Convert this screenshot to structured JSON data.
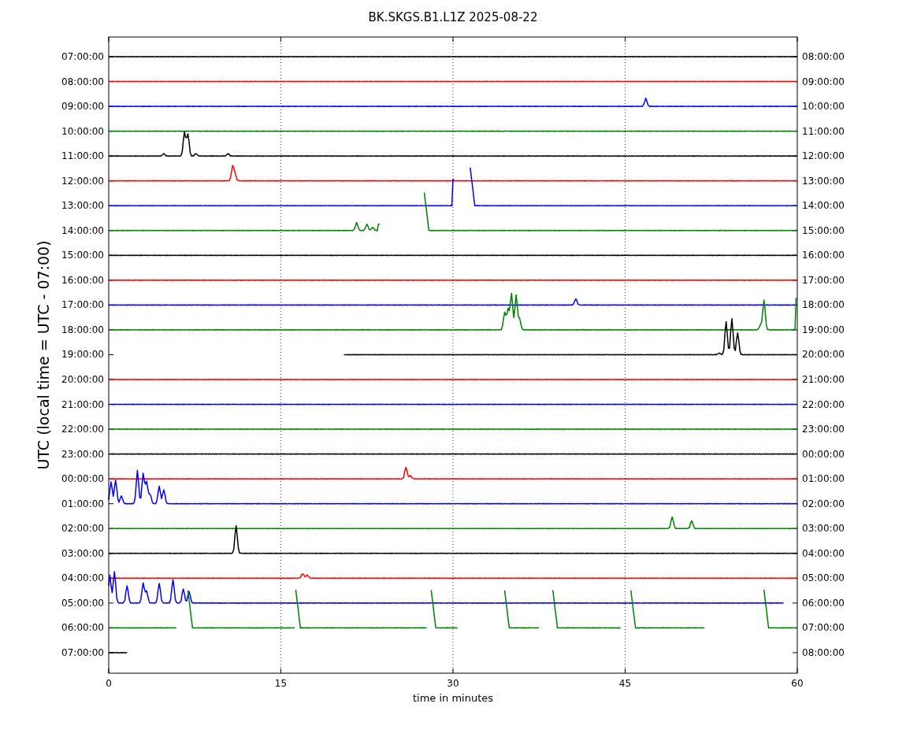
{
  "title": "BK.SKGS.B1.L1Z 2025-08-22",
  "ylabel": "UTC (local time = UTC - 07:00)",
  "xlabel": "time in minutes",
  "xticks": [
    "0",
    "15",
    "30",
    "45",
    "60"
  ],
  "rows": [
    {
      "left": "07:00:00",
      "right": "08:00:00",
      "color": "#000000"
    },
    {
      "left": "08:00:00",
      "right": "09:00:00",
      "color": "#ff0000"
    },
    {
      "left": "09:00:00",
      "right": "10:00:00",
      "color": "#0000ff"
    },
    {
      "left": "10:00:00",
      "right": "11:00:00",
      "color": "#008000"
    },
    {
      "left": "11:00:00",
      "right": "12:00:00",
      "color": "#000000"
    },
    {
      "left": "12:00:00",
      "right": "13:00:00",
      "color": "#ff0000"
    },
    {
      "left": "13:00:00",
      "right": "14:00:00",
      "color": "#0000ff"
    },
    {
      "left": "14:00:00",
      "right": "15:00:00",
      "color": "#008000"
    },
    {
      "left": "15:00:00",
      "right": "16:00:00",
      "color": "#000000"
    },
    {
      "left": "16:00:00",
      "right": "17:00:00",
      "color": "#ff0000"
    },
    {
      "left": "17:00:00",
      "right": "18:00:00",
      "color": "#0000ff"
    },
    {
      "left": "18:00:00",
      "right": "19:00:00",
      "color": "#008000"
    },
    {
      "left": "19:00:00",
      "right": "20:00:00",
      "color": "#000000"
    },
    {
      "left": "20:00:00",
      "right": "21:00:00",
      "color": "#ff0000"
    },
    {
      "left": "21:00:00",
      "right": "22:00:00",
      "color": "#0000ff"
    },
    {
      "left": "22:00:00",
      "right": "23:00:00",
      "color": "#008000"
    },
    {
      "left": "23:00:00",
      "right": "00:00:00",
      "color": "#000000"
    },
    {
      "left": "00:00:00",
      "right": "01:00:00",
      "color": "#ff0000"
    },
    {
      "left": "01:00:00",
      "right": "02:00:00",
      "color": "#0000ff"
    },
    {
      "left": "02:00:00",
      "right": "03:00:00",
      "color": "#008000"
    },
    {
      "left": "03:00:00",
      "right": "04:00:00",
      "color": "#000000"
    },
    {
      "left": "04:00:00",
      "right": "05:00:00",
      "color": "#ff0000"
    },
    {
      "left": "05:00:00",
      "right": "06:00:00",
      "color": "#0000ff"
    },
    {
      "left": "06:00:00",
      "right": "07:00:00",
      "color": "#008000"
    },
    {
      "left": "07:00:00",
      "right": "08:00:00",
      "color": "#000000"
    }
  ]
}
